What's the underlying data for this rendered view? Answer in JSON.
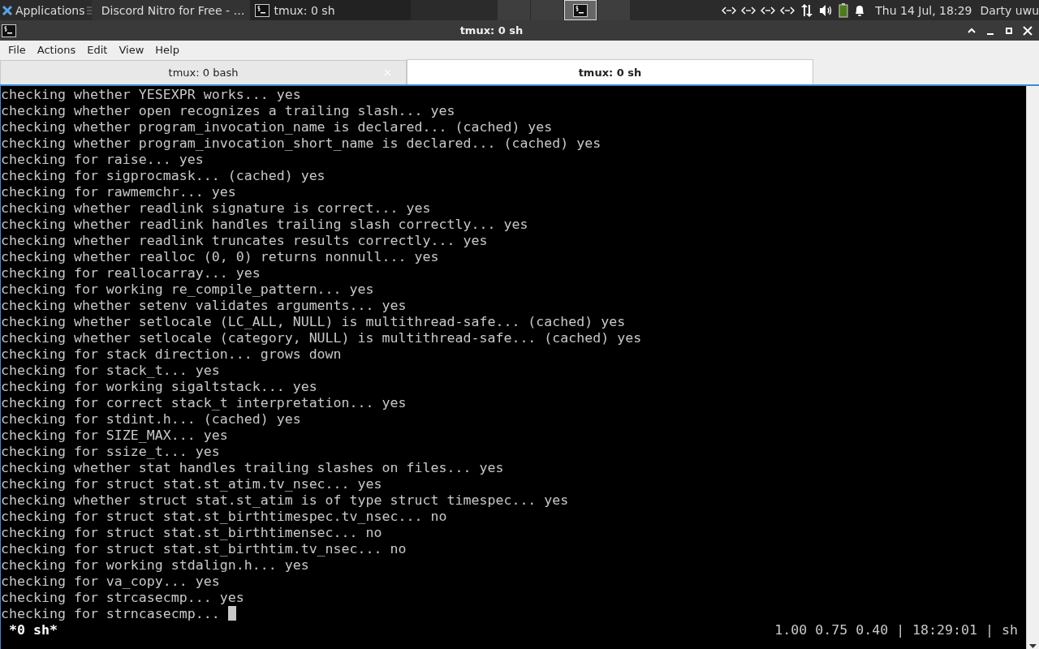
{
  "panel": {
    "app_menu": "Applications",
    "tasks": [
      {
        "label": "Discord Nitro for Free - …",
        "kind": "browser",
        "selected": false
      },
      {
        "label": "tmux: 0 sh",
        "kind": "terminal",
        "selected": true
      }
    ],
    "workspaces": [
      {
        "selected": false
      },
      {
        "selected": false
      },
      {
        "selected": true
      },
      {
        "selected": false
      }
    ],
    "clock": "Thu 14 Jul, 18:29",
    "user": "Darty uwu"
  },
  "window": {
    "title": "tmux: 0 sh"
  },
  "menu": [
    "File",
    "Actions",
    "Edit",
    "View",
    "Help"
  ],
  "tabs": [
    {
      "label": "tmux: 0 bash",
      "selected": false
    },
    {
      "label": "tmux: 0 sh",
      "selected": true
    }
  ],
  "terminal": {
    "lines": [
      "checking whether YESEXPR works... yes",
      "checking whether open recognizes a trailing slash... yes",
      "checking whether program_invocation_name is declared... (cached) yes",
      "checking whether program_invocation_short_name is declared... (cached) yes",
      "checking for raise... yes",
      "checking for sigprocmask... (cached) yes",
      "checking for rawmemchr... yes",
      "checking whether readlink signature is correct... yes",
      "checking whether readlink handles trailing slash correctly... yes",
      "checking whether readlink truncates results correctly... yes",
      "checking whether realloc (0, 0) returns nonnull... yes",
      "checking for reallocarray... yes",
      "checking for working re_compile_pattern... yes",
      "checking whether setenv validates arguments... yes",
      "checking whether setlocale (LC_ALL, NULL) is multithread-safe... (cached) yes",
      "checking whether setlocale (category, NULL) is multithread-safe... (cached) yes",
      "checking for stack direction... grows down",
      "checking for stack_t... yes",
      "checking for working sigaltstack... yes",
      "checking for correct stack_t interpretation... yes",
      "checking for stdint.h... (cached) yes",
      "checking for SIZE_MAX... yes",
      "checking for ssize_t... yes",
      "checking whether stat handles trailing slashes on files... yes",
      "checking for struct stat.st_atim.tv_nsec... yes",
      "checking whether struct stat.st_atim is of type struct timespec... yes",
      "checking for struct stat.st_birthtimespec.tv_nsec... no",
      "checking for struct stat.st_birthtimensec... no",
      "checking for struct stat.st_birthtim.tv_nsec... no",
      "checking for working stdalign.h... yes",
      "checking for va_copy... yes",
      "checking for strcasecmp... yes",
      "checking for strncasecmp... "
    ],
    "status_left": "*0 sh*",
    "status_right": "1.00 0.75 0.40 | 18:29:01 | sh"
  }
}
